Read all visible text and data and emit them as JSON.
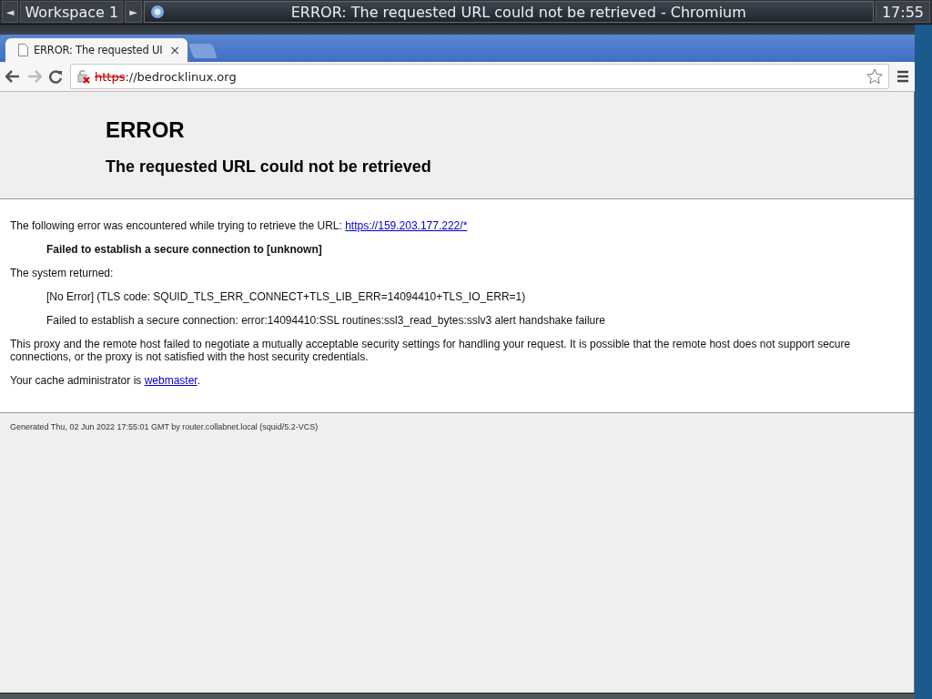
{
  "panel": {
    "workspace": "Workspace 1",
    "prev": "◄",
    "next": "►",
    "task_title": "ERROR: The requested URL could not be retrieved - Chromium",
    "clock": "17:55"
  },
  "tabs": [
    {
      "title": "ERROR: The requested UI",
      "close": "×",
      "selected": true
    }
  ],
  "toolbar": {
    "url_scheme": "https",
    "url_rest": "://bedrocklinux.org"
  },
  "page": {
    "heading": "ERROR",
    "subheading": "The requested URL could not be retrieved",
    "intro": "The following error was encountered while trying to retrieve the URL:",
    "intro_link": "https://159.203.177.222/*",
    "error_detail": "Failed to establish a secure connection to [unknown]",
    "system_label": "The system returned:",
    "system_lines": [
      "[No Error] (TLS code: SQUID_TLS_ERR_CONNECT+TLS_LIB_ERR=14094410+TLS_IO_ERR=1)",
      "Failed to establish a secure connection: error:14094410:SSL routines:ssl3_read_bytes:sslv3 alert handshake failure"
    ],
    "explanation": "This proxy and the remote host failed to negotiate a mutually acceptable security settings for handling your request. It is possible that the remote host does not support secure connections, or the proxy is not satisfied with the host security credentials.",
    "admin_text": "Your cache administrator is",
    "admin_link": "webmaster",
    "admin_end": ".",
    "footer": "Generated Thu, 02 Jun 2022 17:55:01 GMT by router.collabnet.local (squid/5.2-VCS)"
  }
}
